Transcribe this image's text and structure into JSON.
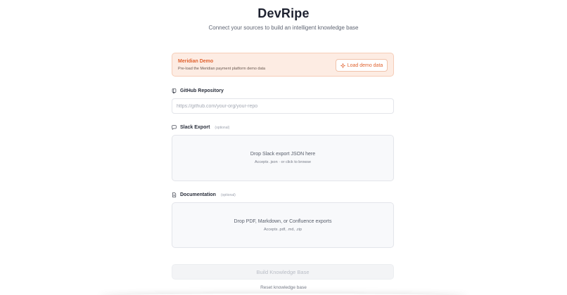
{
  "app": {
    "title": "DevRipe",
    "subtitle": "Connect your sources to build an intelligent knowledge base"
  },
  "demo": {
    "title": "Meridian Demo",
    "description": "Pre-load the Meridian payment platform demo data",
    "button_label": "Load demo data",
    "accent_color": "#e0622f"
  },
  "github": {
    "label": "GitHub Repository",
    "icon": "repo-icon",
    "placeholder": "https://github.com/your-org/your-repo",
    "value": ""
  },
  "slack": {
    "label": "Slack Export",
    "optional": "(optional)",
    "icon": "chat-bubble-icon",
    "drop_text": "Drop Slack export JSON here",
    "accepts_text": "Accepts .json · or click to browse"
  },
  "docs": {
    "label": "Documentation",
    "optional": "(optional)",
    "icon": "document-icon",
    "drop_text": "Drop PDF, Markdown, or Confluence exports",
    "accepts_text": "Accepts .pdf, .md, .zip"
  },
  "actions": {
    "build_label": "Build Knowledge Base",
    "reset_label": "Reset knowledge base"
  }
}
